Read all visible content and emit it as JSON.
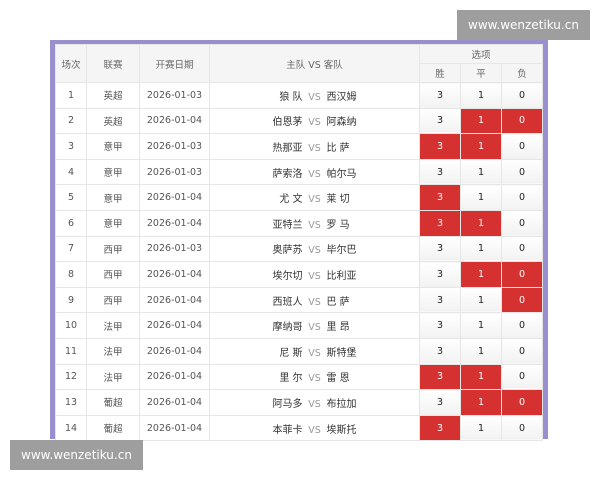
{
  "watermark": "www.wenzetiku.cn",
  "header": {
    "no": "场次",
    "league": "联赛",
    "date": "开赛日期",
    "home": "主队",
    "vs": "VS",
    "away": "客队",
    "options": "选项",
    "win": "胜",
    "draw": "平",
    "loss": "负"
  },
  "colors": {
    "selected": "#d63131",
    "frame": "#9a8fce"
  },
  "rows": [
    {
      "no": "1",
      "league": "英超",
      "date": "2026-01-03",
      "home": "狼 队",
      "away": "西汉姆",
      "w": "3",
      "d": "1",
      "l": "0",
      "sel": [
        false,
        false,
        false
      ]
    },
    {
      "no": "2",
      "league": "英超",
      "date": "2026-01-04",
      "home": "伯恩茅",
      "away": "阿森纳",
      "w": "3",
      "d": "1",
      "l": "0",
      "sel": [
        false,
        true,
        true
      ]
    },
    {
      "no": "3",
      "league": "意甲",
      "date": "2026-01-03",
      "home": "热那亚",
      "away": "比 萨",
      "w": "3",
      "d": "1",
      "l": "0",
      "sel": [
        true,
        true,
        false
      ]
    },
    {
      "no": "4",
      "league": "意甲",
      "date": "2026-01-03",
      "home": "萨索洛",
      "away": "帕尔马",
      "w": "3",
      "d": "1",
      "l": "0",
      "sel": [
        false,
        false,
        false
      ]
    },
    {
      "no": "5",
      "league": "意甲",
      "date": "2026-01-04",
      "home": "尤 文",
      "away": "莱 切",
      "w": "3",
      "d": "1",
      "l": "0",
      "sel": [
        true,
        false,
        false
      ]
    },
    {
      "no": "6",
      "league": "意甲",
      "date": "2026-01-04",
      "home": "亚特兰",
      "away": "罗 马",
      "w": "3",
      "d": "1",
      "l": "0",
      "sel": [
        true,
        true,
        false
      ]
    },
    {
      "no": "7",
      "league": "西甲",
      "date": "2026-01-03",
      "home": "奥萨苏",
      "away": "毕尔巴",
      "w": "3",
      "d": "1",
      "l": "0",
      "sel": [
        false,
        false,
        false
      ]
    },
    {
      "no": "8",
      "league": "西甲",
      "date": "2026-01-04",
      "home": "埃尔切",
      "away": "比利亚",
      "w": "3",
      "d": "1",
      "l": "0",
      "sel": [
        false,
        true,
        true
      ]
    },
    {
      "no": "9",
      "league": "西甲",
      "date": "2026-01-04",
      "home": "西班人",
      "away": "巴 萨",
      "w": "3",
      "d": "1",
      "l": "0",
      "sel": [
        false,
        false,
        true
      ]
    },
    {
      "no": "10",
      "league": "法甲",
      "date": "2026-01-04",
      "home": "摩纳哥",
      "away": "里 昂",
      "w": "3",
      "d": "1",
      "l": "0",
      "sel": [
        false,
        false,
        false
      ]
    },
    {
      "no": "11",
      "league": "法甲",
      "date": "2026-01-04",
      "home": "尼 斯",
      "away": "斯特堡",
      "w": "3",
      "d": "1",
      "l": "0",
      "sel": [
        false,
        false,
        false
      ]
    },
    {
      "no": "12",
      "league": "法甲",
      "date": "2026-01-04",
      "home": "里 尔",
      "away": "雷 恩",
      "w": "3",
      "d": "1",
      "l": "0",
      "sel": [
        true,
        true,
        false
      ]
    },
    {
      "no": "13",
      "league": "葡超",
      "date": "2026-01-04",
      "home": "阿马多",
      "away": "布拉加",
      "w": "3",
      "d": "1",
      "l": "0",
      "sel": [
        false,
        true,
        true
      ]
    },
    {
      "no": "14",
      "league": "葡超",
      "date": "2026-01-04",
      "home": "本菲卡",
      "away": "埃斯托",
      "w": "3",
      "d": "1",
      "l": "0",
      "sel": [
        true,
        false,
        false
      ]
    }
  ]
}
